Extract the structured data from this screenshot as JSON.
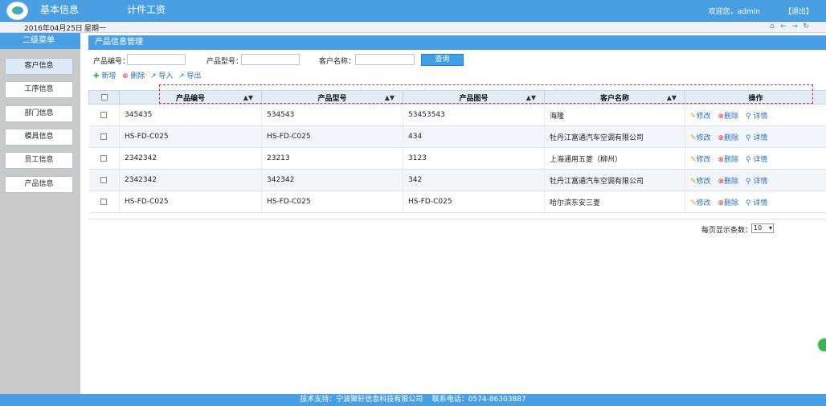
{
  "header": {
    "nav": [
      "基本信息",
      "计件工资"
    ],
    "welcome": "欢迎您，admin",
    "logout": "【退出】"
  },
  "datebar": {
    "date": "2016年04月25日",
    "weekday": "星期一",
    "icons": [
      "home-icon",
      "arrow-left-icon",
      "arrow-right-icon",
      "refresh-icon"
    ]
  },
  "sidebar": {
    "title": "二级菜单",
    "items": [
      {
        "label": "客户信息",
        "active": true
      },
      {
        "label": "工序信息"
      },
      {
        "label": "部门信息"
      },
      {
        "label": "模具信息"
      },
      {
        "label": "员工信息"
      },
      {
        "label": "产品信息"
      }
    ]
  },
  "main": {
    "title": "产品信息管理",
    "search": {
      "product_no_label": "产品编号：",
      "product_model_label": "产品型号：",
      "customer_label": "客户名称：",
      "button": "查询"
    },
    "toolbar": {
      "add": "新增",
      "delete": "删除",
      "import": "导入",
      "export": "导出"
    },
    "table": {
      "headers": [
        "产品编号",
        "产品型号",
        "产品图号",
        "客户名称",
        "操作"
      ],
      "rows": [
        [
          "345435",
          "534543",
          "53453543",
          "海隆"
        ],
        [
          "HS-FD-C025",
          "HS-FD-C025",
          "434",
          "牡丹江富通汽车空调有限公司"
        ],
        [
          "2342342",
          "23213",
          "3123",
          "上海通用五菱（柳州）"
        ],
        [
          "2342342",
          "342342",
          "342",
          "牡丹江富通汽车空调有限公司"
        ],
        [
          "HS-FD-C025",
          "HS-FD-C025",
          "HS-FD-C025",
          "哈尔滨东安三菱"
        ]
      ],
      "actions": [
        "修改",
        "删除",
        "详情"
      ]
    },
    "pager": {
      "label": "每页显示条数：",
      "value": "10"
    }
  },
  "footer": {
    "support": "技术支持：宁波聚轩信息科技有限公司",
    "phone": "联系电话：0574-86303887"
  },
  "colors": {
    "primary": "#4a9fe3",
    "sidebar_bg": "#c9c9c9"
  }
}
